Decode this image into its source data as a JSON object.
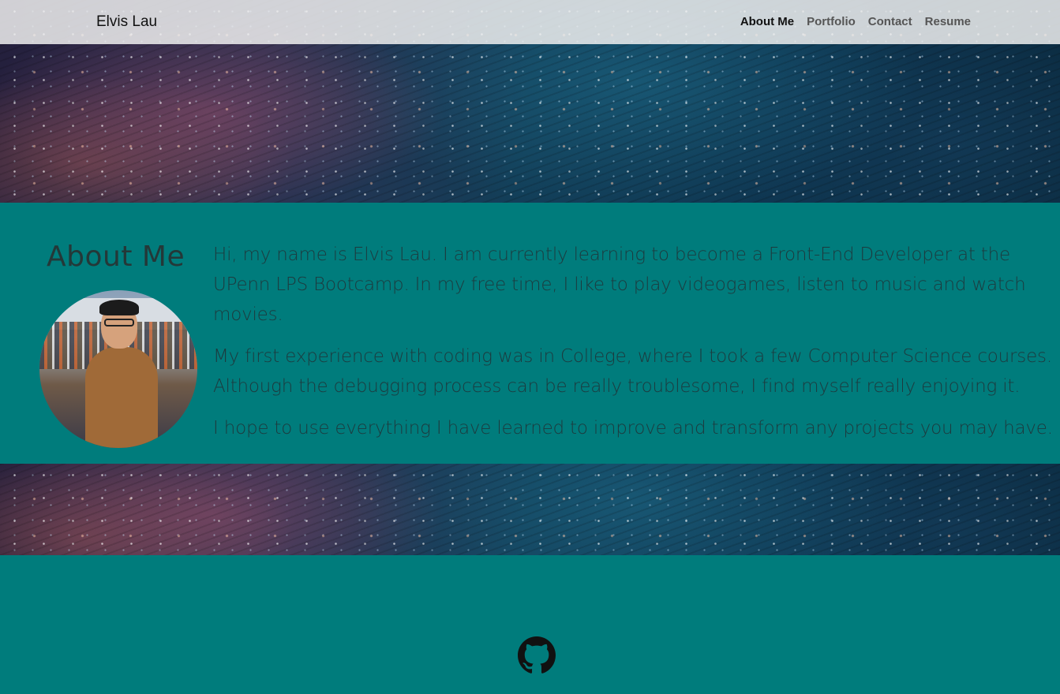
{
  "navbar": {
    "brand": "Elvis Lau",
    "links": [
      {
        "label": "About Me",
        "active": true
      },
      {
        "label": "Portfolio",
        "active": false
      },
      {
        "label": "Contact",
        "active": false
      },
      {
        "label": "Resume",
        "active": false
      }
    ]
  },
  "about": {
    "title": "About Me",
    "paragraphs": [
      "Hi, my name is Elvis Lau. I am currently learning to become a Front-End Developer at the UPenn LPS Bootcamp. In my free time, I like to play videogames, listen to music and watch movies.",
      "My first experience with coding was in College, where I took a few Computer Science courses. Although the debugging process can be really troublesome, I find myself really enjoying it.",
      "I hope to use everything I have learned to improve and transform any projects you may have."
    ]
  },
  "footer": {
    "icon": "github-icon"
  },
  "colors": {
    "accent": "#007c7c",
    "navbar_bg": "#f0f0f0",
    "text": "#1d3a3e"
  }
}
